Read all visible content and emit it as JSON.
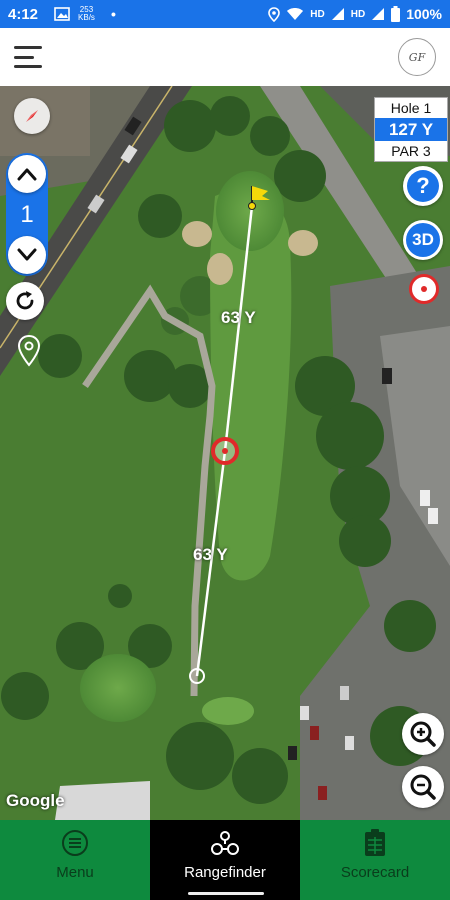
{
  "status_bar": {
    "time": "4:12",
    "net_speed_value": "253",
    "net_speed_unit": "KB/s",
    "network_label_1": "HD",
    "network_label_2": "HD",
    "battery_percent": "100%"
  },
  "header": {
    "menu_icon": "hamburger-icon",
    "logo_text": "GF"
  },
  "map": {
    "hole_number": "1",
    "distance_labels": [
      "63 Y",
      "63 Y"
    ],
    "attribution": "Google"
  },
  "hole_info": {
    "hole_label": "Hole 1",
    "yardage": "127 Y",
    "par_label": "PAR 3"
  },
  "controls": {
    "help_label": "?",
    "view_3d_label": "3D"
  },
  "bottom_nav": {
    "tabs": [
      {
        "label": "Menu",
        "icon": "menu-circle-icon",
        "active": false
      },
      {
        "label": "Rangefinder",
        "icon": "rangefinder-icon",
        "active": true
      },
      {
        "label": "Scorecard",
        "icon": "scorecard-icon",
        "active": false
      }
    ]
  },
  "colors": {
    "accent_blue": "#1a73e8",
    "nav_green": "#0e8a3e",
    "target_red": "#e02a2a",
    "flag_yellow": "#f5d90a"
  }
}
